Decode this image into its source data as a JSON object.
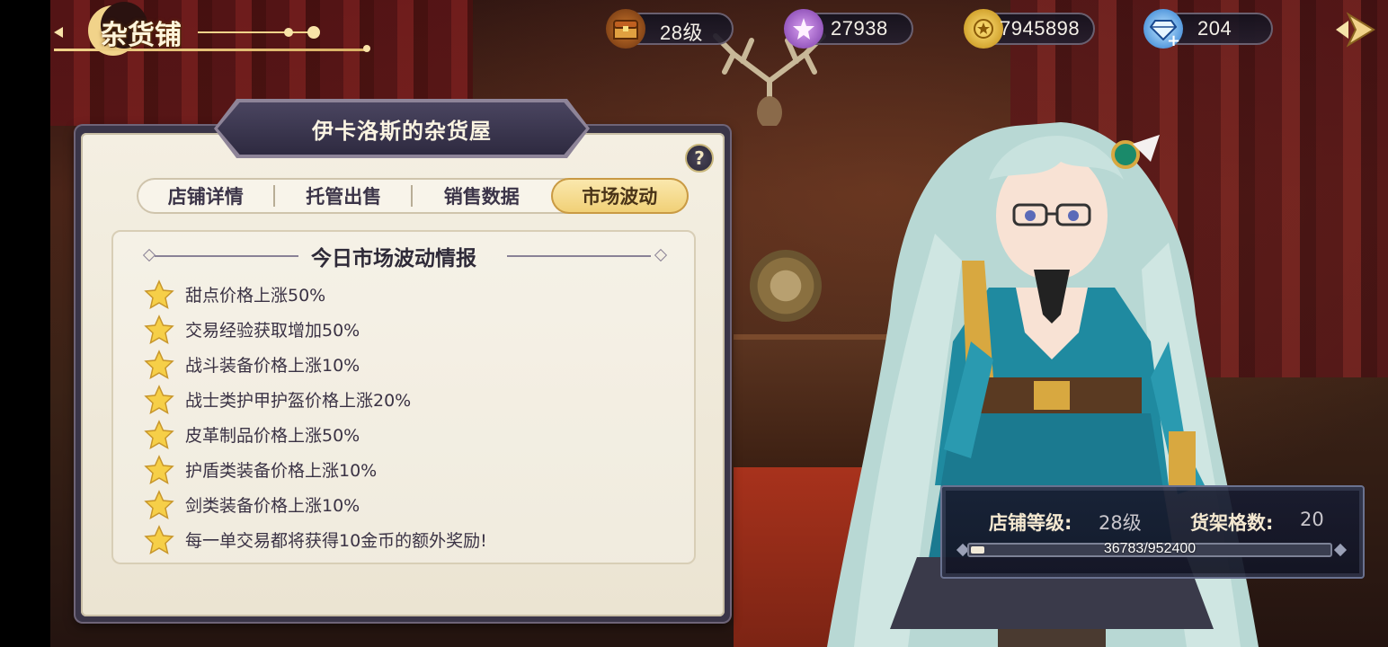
{
  "logo": {
    "title": "杂货铺"
  },
  "resources": {
    "level": {
      "value": "28级",
      "icon": "treasure-chest-icon"
    },
    "gems_purple": {
      "value": "27938",
      "icon": "purple-star-coin-icon"
    },
    "gold": {
      "value": "7945898",
      "icon": "gold-coin-icon"
    },
    "diamonds": {
      "value": "204",
      "icon": "blue-diamond-icon",
      "plus": "+"
    }
  },
  "panel": {
    "title": "伊卡洛斯的杂货屋",
    "help": "?",
    "tabs": [
      {
        "label": "店铺详情",
        "active": false
      },
      {
        "label": "托管出售",
        "active": false
      },
      {
        "label": "销售数据",
        "active": false
      },
      {
        "label": "市场波动",
        "active": true
      }
    ],
    "section_title": "今日市场波动情报",
    "items": [
      "甜点价格上涨50%",
      "交易经验获取增加50%",
      "战斗装备价格上涨10%",
      "战士类护甲护盔价格上涨20%",
      "皮革制品价格上涨50%",
      "护盾类装备价格上涨10%",
      "剑类装备价格上涨10%",
      "每一单交易都将获得10金币的额外奖励!"
    ]
  },
  "shop_status": {
    "level_label": "店铺等级:",
    "level_value": "28级",
    "shelf_label": "货架格数:",
    "shelf_value": "20",
    "exp_text": "36783/952400",
    "exp_fraction": 0.0386
  },
  "colors": {
    "accent_gold": "#f0cf74",
    "panel_dark": "#3a3548",
    "paper": "#f4efe2"
  }
}
